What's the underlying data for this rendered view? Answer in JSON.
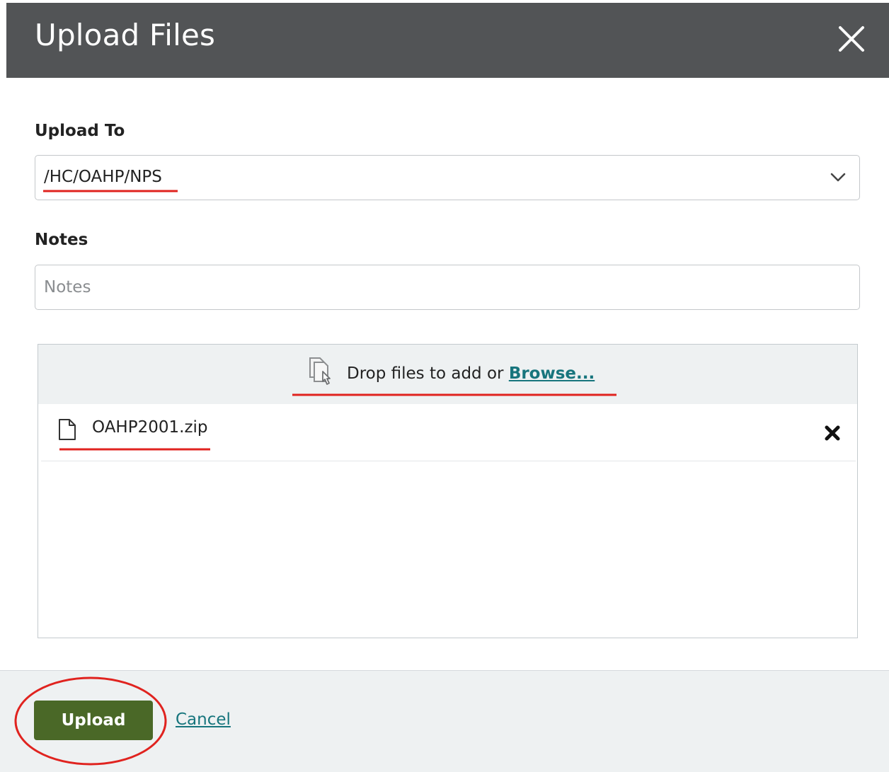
{
  "dialog": {
    "title": "Upload Files",
    "close_icon": "close-icon"
  },
  "upload_to": {
    "label": "Upload To",
    "selected_value": "/HC/OAHP/NPS",
    "dropdown_icon": "chevron-down-icon"
  },
  "notes": {
    "label": "Notes",
    "placeholder": "Notes",
    "value": ""
  },
  "dropzone": {
    "icon": "drop-files-icon",
    "text": "Drop files to add or ",
    "browse_label": "Browse...",
    "files": [
      {
        "name": "OAHP2001.zip",
        "icon": "file-icon",
        "remove_icon": "remove-x-icon"
      }
    ]
  },
  "footer": {
    "upload_label": "Upload",
    "cancel_label": "Cancel"
  },
  "colors": {
    "header_bg": "#525456",
    "primary_button": "#4a6827",
    "link": "#17757d",
    "annotation": "#e0231f",
    "footer_bg": "#eef1f2"
  }
}
